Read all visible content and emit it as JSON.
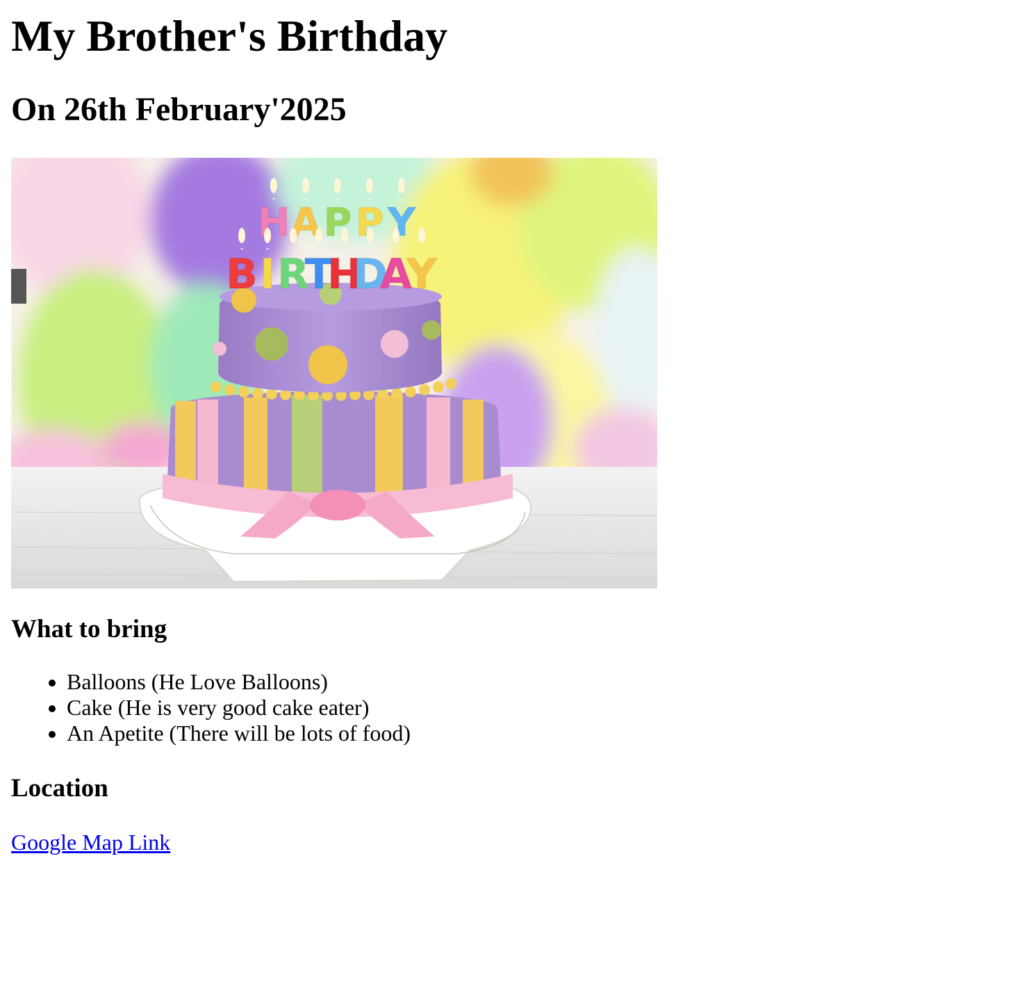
{
  "header": {
    "title": "My Brother's Birthday",
    "subtitle": "On 26th February'2025"
  },
  "hero_image": {
    "candle_letters_top": [
      "H",
      "A",
      "P",
      "P",
      "Y"
    ],
    "candle_letters_bottom": [
      "B",
      "I",
      "R",
      "T",
      "H",
      "D",
      "A",
      "Y"
    ],
    "colors": {
      "cake_purple": "#a98bd0",
      "cake_pink": "#f5b8cf",
      "cake_yellow": "#f2c95a",
      "cake_green": "#b7cf78",
      "balloon_yellow": "#f6f07a",
      "balloon_green": "#c8ef7e",
      "balloon_purple": "#b487e8",
      "balloon_pink": "#f6c3df",
      "table": "#e9e9ea"
    }
  },
  "bring": {
    "heading": "What to bring",
    "items": [
      "Balloons (He Love Balloons)",
      "Cake (He is very good cake eater)",
      "An Apetite (There will be lots of food)"
    ]
  },
  "location": {
    "heading": "Location",
    "link_text": "Google Map Link"
  }
}
